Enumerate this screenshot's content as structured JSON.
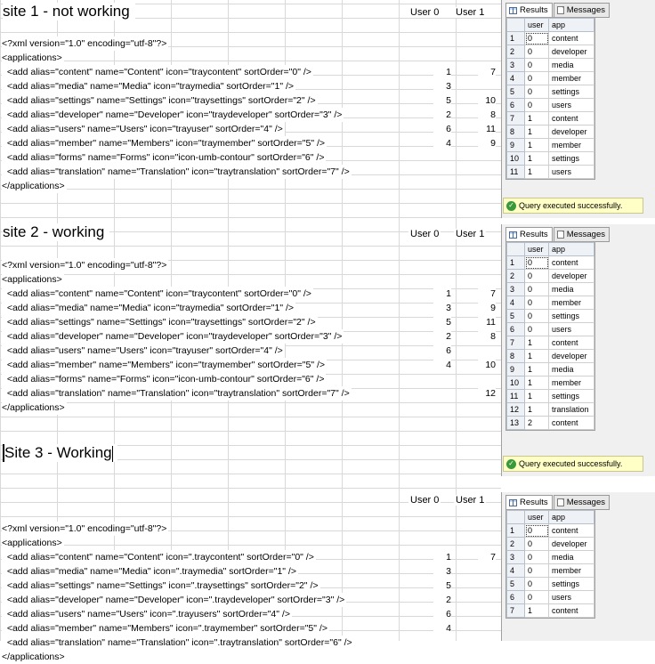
{
  "col_headers": {
    "user0": "User 0",
    "user1": "User 1"
  },
  "tabs": {
    "results": "Results",
    "messages": "Messages"
  },
  "grid_headers": {
    "user": "user",
    "app": "app"
  },
  "status_text": "Query executed successfully.",
  "sites": [
    {
      "title": "site 1 - not working",
      "lines": [
        {
          "text": "<?xml version=\"1.0\" encoding=\"utf-8\"?>",
          "u0": "",
          "u1": ""
        },
        {
          "text": "<applications>",
          "u0": "",
          "u1": ""
        },
        {
          "text": "  <add alias=\"content\" name=\"Content\" icon=\"traycontent\" sortOrder=\"0\" />",
          "u0": "1",
          "u1": "7"
        },
        {
          "text": "  <add alias=\"media\" name=\"Media\" icon=\"traymedia\" sortOrder=\"1\" />",
          "u0": "3",
          "u1": ""
        },
        {
          "text": "  <add alias=\"settings\" name=\"Settings\" icon=\"traysettings\" sortOrder=\"2\" />",
          "u0": "5",
          "u1": "10"
        },
        {
          "text": "  <add alias=\"developer\" name=\"Developer\" icon=\"traydeveloper\" sortOrder=\"3\" />",
          "u0": "2",
          "u1": "8"
        },
        {
          "text": "  <add alias=\"users\" name=\"Users\" icon=\"trayuser\" sortOrder=\"4\" />",
          "u0": "6",
          "u1": "11"
        },
        {
          "text": "  <add alias=\"member\" name=\"Members\" icon=\"traymember\" sortOrder=\"5\" />",
          "u0": "4",
          "u1": "9"
        },
        {
          "text": "  <add alias=\"forms\" name=\"Forms\" icon=\"icon-umb-contour\" sortOrder=\"6\" />",
          "u0": "",
          "u1": ""
        },
        {
          "text": "  <add alias=\"translation\" name=\"Translation\" icon=\"traytranslation\" sortOrder=\"7\" />",
          "u0": "",
          "u1": ""
        },
        {
          "text": "</applications>",
          "u0": "",
          "u1": ""
        }
      ],
      "rows": [
        {
          "n": "1",
          "user": "0",
          "app": "content"
        },
        {
          "n": "2",
          "user": "0",
          "app": "developer"
        },
        {
          "n": "3",
          "user": "0",
          "app": "media"
        },
        {
          "n": "4",
          "user": "0",
          "app": "member"
        },
        {
          "n": "5",
          "user": "0",
          "app": "settings"
        },
        {
          "n": "6",
          "user": "0",
          "app": "users"
        },
        {
          "n": "7",
          "user": "1",
          "app": "content"
        },
        {
          "n": "8",
          "user": "1",
          "app": "developer"
        },
        {
          "n": "9",
          "user": "1",
          "app": "member"
        },
        {
          "n": "10",
          "user": "1",
          "app": "settings"
        },
        {
          "n": "11",
          "user": "1",
          "app": "users"
        }
      ]
    },
    {
      "title": "site 2 - working",
      "lines": [
        {
          "text": "<?xml version=\"1.0\" encoding=\"utf-8\"?>",
          "u0": "",
          "u1": ""
        },
        {
          "text": "<applications>",
          "u0": "",
          "u1": ""
        },
        {
          "text": "  <add alias=\"content\" name=\"Content\" icon=\"traycontent\" sortOrder=\"0\" />",
          "u0": "1",
          "u1": "7"
        },
        {
          "text": "  <add alias=\"media\" name=\"Media\" icon=\"traymedia\" sortOrder=\"1\" />",
          "u0": "3",
          "u1": "9"
        },
        {
          "text": "  <add alias=\"settings\" name=\"Settings\" icon=\"traysettings\" sortOrder=\"2\" />",
          "u0": "5",
          "u1": "11"
        },
        {
          "text": "  <add alias=\"developer\" name=\"Developer\" icon=\"traydeveloper\" sortOrder=\"3\" />",
          "u0": "2",
          "u1": "8"
        },
        {
          "text": "  <add alias=\"users\" name=\"Users\" icon=\"trayuser\" sortOrder=\"4\" />",
          "u0": "6",
          "u1": ""
        },
        {
          "text": "  <add alias=\"member\" name=\"Members\" icon=\"traymember\" sortOrder=\"5\" />",
          "u0": "4",
          "u1": "10"
        },
        {
          "text": "  <add alias=\"forms\" name=\"Forms\" icon=\"icon-umb-contour\" sortOrder=\"6\" />",
          "u0": "",
          "u1": ""
        },
        {
          "text": "  <add alias=\"translation\" name=\"Translation\" icon=\"traytranslation\" sortOrder=\"7\" />",
          "u0": "",
          "u1": "12"
        },
        {
          "text": "</applications>",
          "u0": "",
          "u1": ""
        }
      ],
      "rows": [
        {
          "n": "1",
          "user": "0",
          "app": "content"
        },
        {
          "n": "2",
          "user": "0",
          "app": "developer"
        },
        {
          "n": "3",
          "user": "0",
          "app": "media"
        },
        {
          "n": "4",
          "user": "0",
          "app": "member"
        },
        {
          "n": "5",
          "user": "0",
          "app": "settings"
        },
        {
          "n": "6",
          "user": "0",
          "app": "users"
        },
        {
          "n": "7",
          "user": "1",
          "app": "content"
        },
        {
          "n": "8",
          "user": "1",
          "app": "developer"
        },
        {
          "n": "9",
          "user": "1",
          "app": "media"
        },
        {
          "n": "10",
          "user": "1",
          "app": "member"
        },
        {
          "n": "11",
          "user": "1",
          "app": "settings"
        },
        {
          "n": "12",
          "user": "1",
          "app": "translation"
        },
        {
          "n": "13",
          "user": "2",
          "app": "content"
        }
      ]
    },
    {
      "title": "Site 3 - Working",
      "lines": [
        {
          "text": "<?xml version=\"1.0\" encoding=\"utf-8\"?>",
          "u0": "",
          "u1": ""
        },
        {
          "text": "<applications>",
          "u0": "",
          "u1": ""
        },
        {
          "text": "  <add alias=\"content\" name=\"Content\" icon=\".traycontent\" sortOrder=\"0\" />",
          "u0": "1",
          "u1": "7"
        },
        {
          "text": "  <add alias=\"media\" name=\"Media\" icon=\".traymedia\" sortOrder=\"1\" />",
          "u0": "3",
          "u1": ""
        },
        {
          "text": "  <add alias=\"settings\" name=\"Settings\" icon=\".traysettings\" sortOrder=\"2\" />",
          "u0": "5",
          "u1": ""
        },
        {
          "text": "  <add alias=\"developer\" name=\"Developer\" icon=\".traydeveloper\" sortOrder=\"3\" />",
          "u0": "2",
          "u1": ""
        },
        {
          "text": "  <add alias=\"users\" name=\"Users\" icon=\".trayusers\" sortOrder=\"4\" />",
          "u0": "6",
          "u1": ""
        },
        {
          "text": "  <add alias=\"member\" name=\"Members\" icon=\".traymember\" sortOrder=\"5\" />",
          "u0": "4",
          "u1": ""
        },
        {
          "text": "  <add alias=\"translation\" name=\"Translation\" icon=\".traytranslation\" sortOrder=\"6\" />",
          "u0": "",
          "u1": ""
        },
        {
          "text": "</applications>",
          "u0": "",
          "u1": ""
        }
      ],
      "rows": [
        {
          "n": "1",
          "user": "0",
          "app": "content"
        },
        {
          "n": "2",
          "user": "0",
          "app": "developer"
        },
        {
          "n": "3",
          "user": "0",
          "app": "media"
        },
        {
          "n": "4",
          "user": "0",
          "app": "member"
        },
        {
          "n": "5",
          "user": "0",
          "app": "settings"
        },
        {
          "n": "6",
          "user": "0",
          "app": "users"
        },
        {
          "n": "7",
          "user": "1",
          "app": "content"
        }
      ]
    }
  ]
}
